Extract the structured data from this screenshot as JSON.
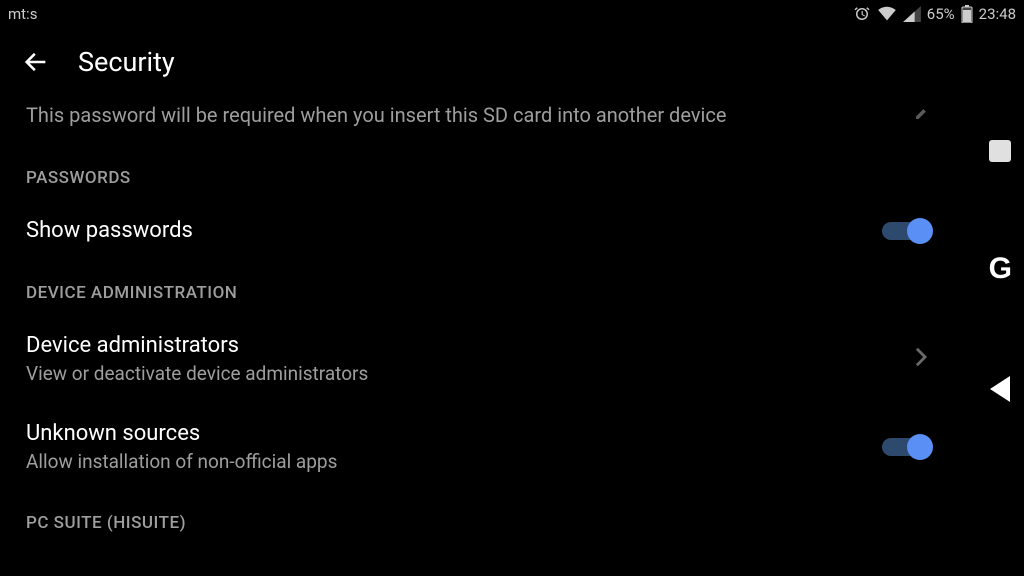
{
  "statusBar": {
    "carrier": "mt:s",
    "batteryPercent": "65%",
    "time": "23:48"
  },
  "appBar": {
    "title": "Security"
  },
  "sdCardRow": {
    "description": "This password will be required when you insert this SD card into another device"
  },
  "sections": {
    "passwords": {
      "header": "PASSWORDS",
      "showPasswords": {
        "title": "Show passwords"
      }
    },
    "deviceAdmin": {
      "header": "DEVICE ADMINISTRATION",
      "administrators": {
        "title": "Device administrators",
        "subtitle": "View or deactivate device administrators"
      },
      "unknownSources": {
        "title": "Unknown sources",
        "subtitle": "Allow installation of non-official apps"
      }
    },
    "pcSuite": {
      "header": "PC SUITE (HISUITE)"
    }
  }
}
